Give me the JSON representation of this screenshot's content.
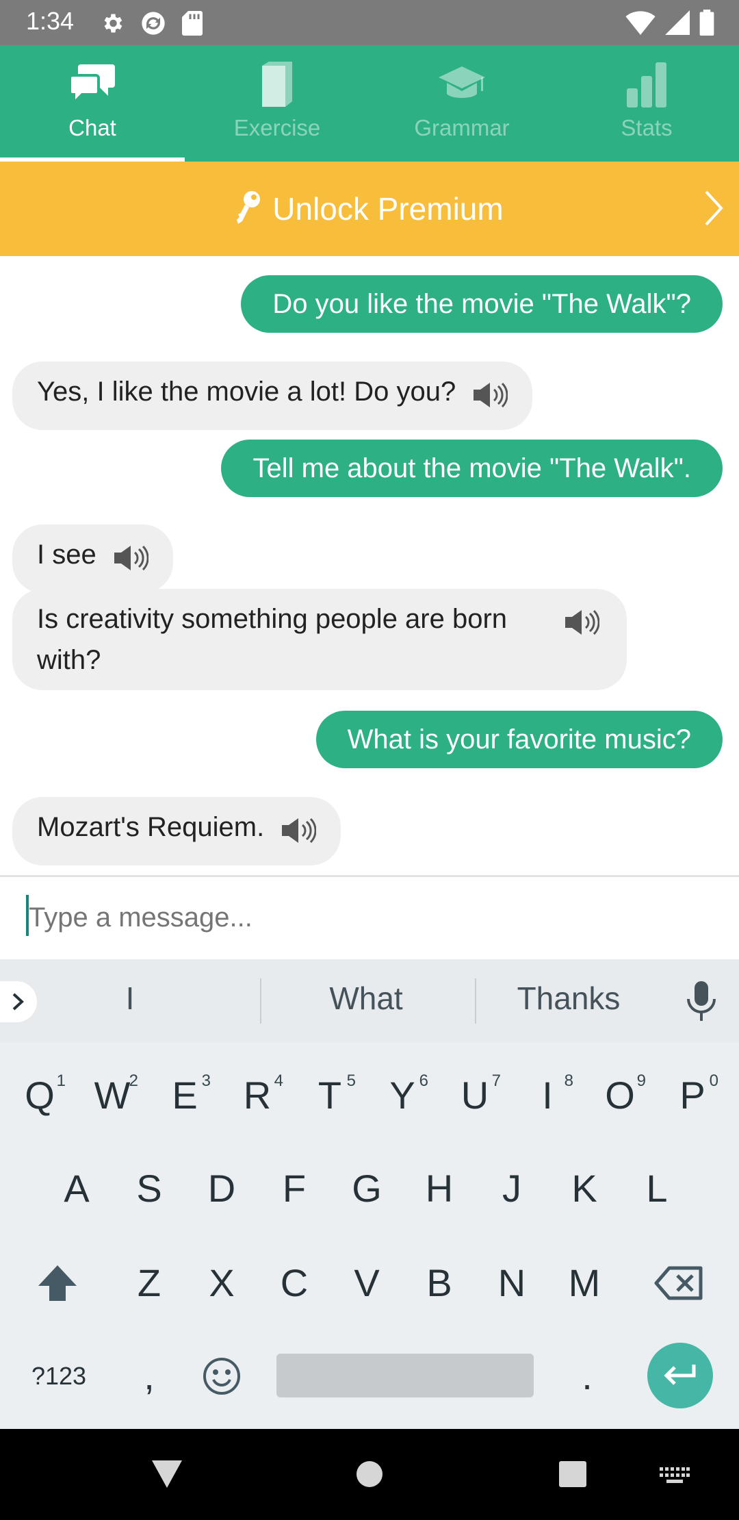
{
  "status_bar": {
    "time": "1:34"
  },
  "tabs": [
    {
      "label": "Chat",
      "icon": "chat-icon",
      "active": true
    },
    {
      "label": "Exercise",
      "icon": "book-icon",
      "active": false
    },
    {
      "label": "Grammar",
      "icon": "graduation-cap-icon",
      "active": false
    },
    {
      "label": "Stats",
      "icon": "bar-chart-icon",
      "active": false
    }
  ],
  "premium": {
    "label": "Unlock Premium",
    "icon": "key-icon"
  },
  "messages": [
    {
      "from": "user",
      "text": "Do you like the movie \"The Walk\"?"
    },
    {
      "from": "bot",
      "text": "Yes, I like the movie a lot! Do you?"
    },
    {
      "from": "user",
      "text": "Tell me about the movie \"The Walk\"."
    },
    {
      "from": "bot",
      "text": "I see"
    },
    {
      "from": "bot",
      "text": "Is creativity something people are born with?"
    },
    {
      "from": "user",
      "text": "What is your favorite music?"
    },
    {
      "from": "bot",
      "text": "Mozart's Requiem."
    }
  ],
  "input": {
    "placeholder": "Type a message..."
  },
  "keyboard": {
    "suggestions": [
      "I",
      "What",
      "Thanks"
    ],
    "row1": [
      {
        "k": "Q",
        "n": "1"
      },
      {
        "k": "W",
        "n": "2"
      },
      {
        "k": "E",
        "n": "3"
      },
      {
        "k": "R",
        "n": "4"
      },
      {
        "k": "T",
        "n": "5"
      },
      {
        "k": "Y",
        "n": "6"
      },
      {
        "k": "U",
        "n": "7"
      },
      {
        "k": "I",
        "n": "8"
      },
      {
        "k": "O",
        "n": "9"
      },
      {
        "k": "P",
        "n": "0"
      }
    ],
    "row2": [
      "A",
      "S",
      "D",
      "F",
      "G",
      "H",
      "J",
      "K",
      "L"
    ],
    "row3": [
      "Z",
      "X",
      "C",
      "V",
      "B",
      "N",
      "M"
    ],
    "symbols_label": "?123",
    "comma": ",",
    "period": "."
  },
  "colors": {
    "brand": "#2eb085",
    "premium": "#f8bd3b",
    "bot_bubble": "#efefef",
    "enter": "#46b7a7"
  }
}
